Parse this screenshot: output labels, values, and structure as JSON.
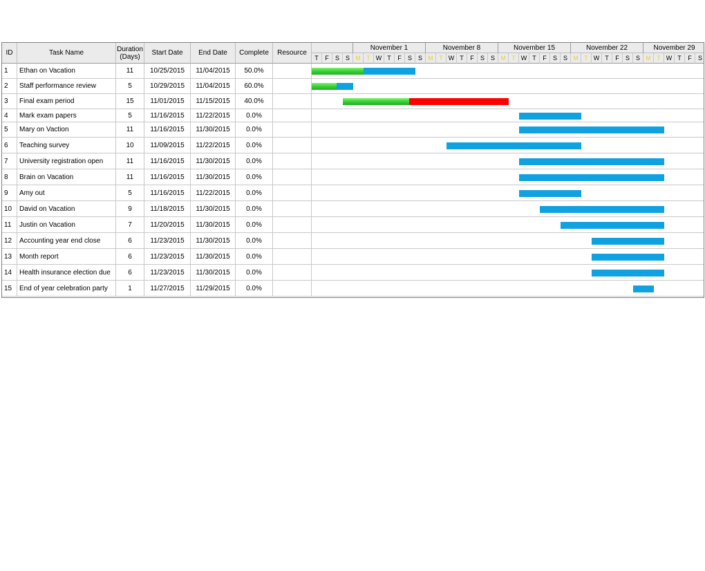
{
  "columns": {
    "id": "ID",
    "name": "Task Name",
    "duration": "Duration\n(Days)",
    "start": "Start Date",
    "end": "End Date",
    "complete": "Complete",
    "resource": "Resource"
  },
  "timeline": {
    "weeks": [
      "",
      "November 1",
      "November 8",
      "November 15",
      "November 22",
      "November 29"
    ],
    "day_letters": [
      "T",
      "F",
      "S",
      "S",
      "M",
      "T",
      "W",
      "T",
      "F",
      "S",
      "S",
      "M",
      "T",
      "W",
      "T",
      "F",
      "S",
      "S",
      "M",
      "T",
      "W",
      "T",
      "F",
      "S",
      "S",
      "M",
      "T",
      "W",
      "T",
      "F",
      "S",
      "S",
      "M",
      "T",
      "W",
      "T",
      "F",
      "S"
    ],
    "weekend_color": "#e6cf3c"
  },
  "colors": {
    "bar": "#10a1e1",
    "progress": "#33cc33",
    "critical": "#ff0000"
  },
  "chart_data": {
    "type": "gantt",
    "timeline_start": "10/27/2015",
    "tasks": [
      {
        "id": "1",
        "name": "Ethan on Vacation",
        "duration": "11",
        "start": "10/25/2015",
        "end": "11/04/2015",
        "complete": "50.0%",
        "complete_value": 0.5,
        "resource": "",
        "bar_start": "10/27/2015",
        "bar_end": "11/06/2015",
        "critical": false
      },
      {
        "id": "2",
        "name": "Staff performance review",
        "duration": "5",
        "start": "10/29/2015",
        "end": "11/04/2015",
        "complete": "60.0%",
        "complete_value": 0.6,
        "resource": "",
        "bar_start": "10/27/2015",
        "bar_end": "10/31/2015",
        "critical": false
      },
      {
        "id": "3",
        "name": "Final exam period",
        "duration": "15",
        "start": "11/01/2015",
        "end": "11/15/2015",
        "complete": "40.0%",
        "complete_value": 0.4,
        "resource": "",
        "bar_start": "10/30/2015",
        "bar_end": "11/15/2015",
        "critical": true
      },
      {
        "id": "4",
        "name": "Mark exam papers",
        "duration": "5",
        "start": "11/16/2015",
        "end": "11/22/2015",
        "complete": "0.0%",
        "complete_value": 0,
        "resource": "",
        "bar_start": "11/16/2015",
        "bar_end": "11/22/2015",
        "critical": false
      },
      {
        "id": "5",
        "name": "Mary on Vaction",
        "duration": "11",
        "start": "11/16/2015",
        "end": "11/30/2015",
        "complete": "0.0%",
        "complete_value": 0,
        "resource": "",
        "bar_start": "11/16/2015",
        "bar_end": "11/30/2015",
        "critical": false
      },
      {
        "id": "6",
        "name": "Teaching survey",
        "duration": "10",
        "start": "11/09/2015",
        "end": "11/22/2015",
        "complete": "0.0%",
        "complete_value": 0,
        "resource": "",
        "bar_start": "11/09/2015",
        "bar_end": "11/22/2015",
        "critical": false
      },
      {
        "id": "7",
        "name": "University registration open",
        "duration": "11",
        "start": "11/16/2015",
        "end": "11/30/2015",
        "complete": "0.0%",
        "complete_value": 0,
        "resource": "",
        "bar_start": "11/16/2015",
        "bar_end": "11/30/2015",
        "critical": false
      },
      {
        "id": "8",
        "name": "Brain on Vacation",
        "duration": "11",
        "start": "11/16/2015",
        "end": "11/30/2015",
        "complete": "0.0%",
        "complete_value": 0,
        "resource": "",
        "bar_start": "11/16/2015",
        "bar_end": "11/30/2015",
        "critical": false
      },
      {
        "id": "9",
        "name": "Amy out",
        "duration": "5",
        "start": "11/16/2015",
        "end": "11/22/2015",
        "complete": "0.0%",
        "complete_value": 0,
        "resource": "",
        "bar_start": "11/16/2015",
        "bar_end": "11/22/2015",
        "critical": false
      },
      {
        "id": "10",
        "name": "David on Vacation",
        "duration": "9",
        "start": "11/18/2015",
        "end": "11/30/2015",
        "complete": "0.0%",
        "complete_value": 0,
        "resource": "",
        "bar_start": "11/18/2015",
        "bar_end": "11/30/2015",
        "critical": false
      },
      {
        "id": "11",
        "name": "Justin on Vacation",
        "duration": "7",
        "start": "11/20/2015",
        "end": "11/30/2015",
        "complete": "0.0%",
        "complete_value": 0,
        "resource": "",
        "bar_start": "11/20/2015",
        "bar_end": "11/30/2015",
        "critical": false
      },
      {
        "id": "12",
        "name": "Accounting year end close",
        "duration": "6",
        "start": "11/23/2015",
        "end": "11/30/2015",
        "complete": "0.0%",
        "complete_value": 0,
        "resource": "",
        "bar_start": "11/23/2015",
        "bar_end": "11/30/2015",
        "critical": false
      },
      {
        "id": "13",
        "name": "Month report",
        "duration": "6",
        "start": "11/23/2015",
        "end": "11/30/2015",
        "complete": "0.0%",
        "complete_value": 0,
        "resource": "",
        "bar_start": "11/23/2015",
        "bar_end": "11/30/2015",
        "critical": false
      },
      {
        "id": "14",
        "name": "Health insurance election due",
        "duration": "6",
        "start": "11/23/2015",
        "end": "11/30/2015",
        "complete": "0.0%",
        "complete_value": 0,
        "resource": "",
        "bar_start": "11/23/2015",
        "bar_end": "11/30/2015",
        "critical": false
      },
      {
        "id": "15",
        "name": "End of year celebration party",
        "duration": "1",
        "start": "11/27/2015",
        "end": "11/29/2015",
        "complete": "0.0%",
        "complete_value": 0,
        "resource": "",
        "bar_start": "11/27/2015",
        "bar_end": "11/29/2015",
        "critical": false
      }
    ]
  }
}
